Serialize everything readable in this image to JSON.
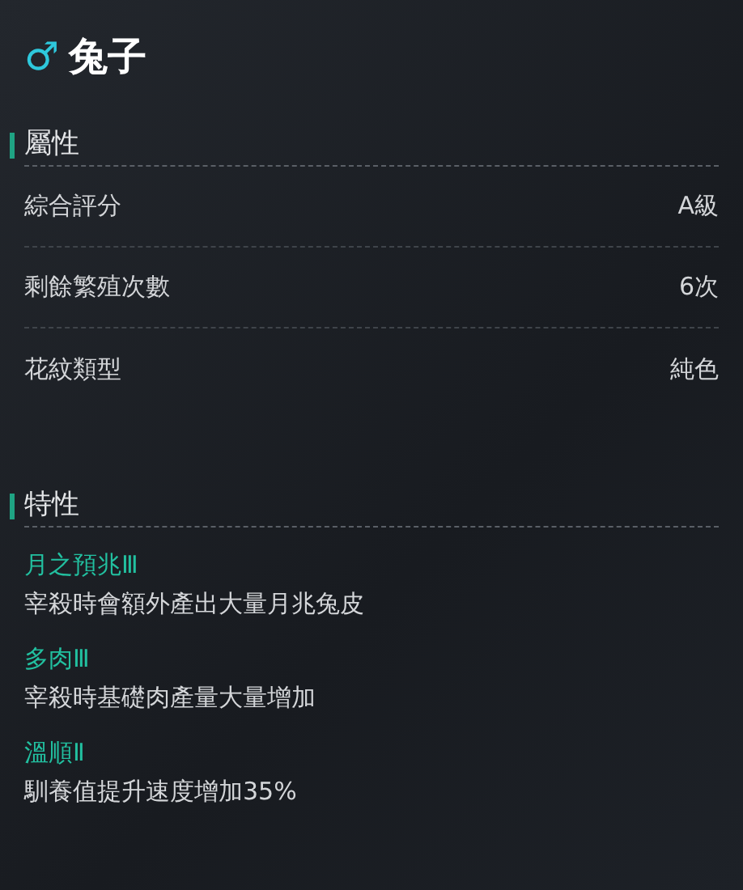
{
  "header": {
    "gender_symbol": "♂",
    "title": "兔子"
  },
  "attributes": {
    "heading": "屬性",
    "rows": [
      {
        "label": "綜合評分",
        "value": "A級"
      },
      {
        "label": "剩餘繁殖次數",
        "value": "6次"
      },
      {
        "label": "花紋類型",
        "value": "純色"
      }
    ]
  },
  "traits": {
    "heading": "特性",
    "items": [
      {
        "name": "月之預兆Ⅲ",
        "description": "宰殺時會額外產出大量月兆兔皮"
      },
      {
        "name": "多肉Ⅲ",
        "description": "宰殺時基礎肉產量大量增加"
      },
      {
        "name": "溫順Ⅱ",
        "description": "馴養值提升速度增加35%"
      }
    ]
  }
}
